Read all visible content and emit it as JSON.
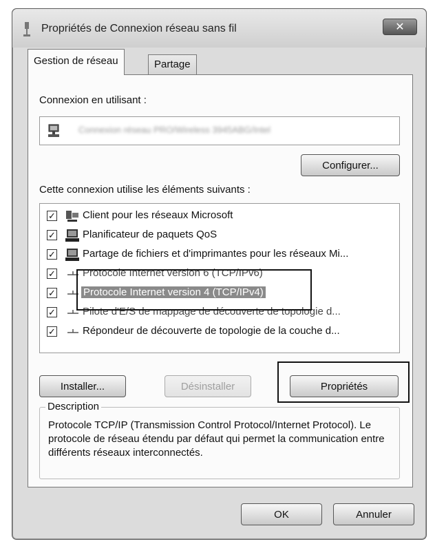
{
  "window": {
    "title": "Propriétés de Connexion réseau sans fil",
    "close_label": "✕"
  },
  "tabs": [
    {
      "label": "Gestion de réseau",
      "active": true
    },
    {
      "label": "Partage",
      "active": false
    }
  ],
  "connection": {
    "label": "Connexion en utilisant :",
    "adapter_name": "Connexion réseau PRO/Wireless 3945ABG/Intel",
    "configure_label": "Configurer..."
  },
  "items_section": {
    "label": "Cette connexion utilise les éléments suivants :",
    "items": [
      {
        "checked": true,
        "icon": "network-client-icon",
        "label": "Client pour les réseaux Microsoft"
      },
      {
        "checked": true,
        "icon": "network-service-icon",
        "label": "Planificateur de paquets QoS"
      },
      {
        "checked": true,
        "icon": "network-service-icon",
        "label": "Partage de fichiers et d'imprimantes pour les réseaux Mi..."
      },
      {
        "checked": true,
        "icon": "protocol-icon",
        "label": "Protocole Internet version 6 (TCP/IPv6)"
      },
      {
        "checked": true,
        "icon": "protocol-icon",
        "label": "Protocole Internet version 4 (TCP/IPv4)",
        "selected": true
      },
      {
        "checked": true,
        "icon": "protocol-icon",
        "label": "Pilote d'E/S de mappage de découverte de topologie d..."
      },
      {
        "checked": true,
        "icon": "protocol-icon",
        "label": "Répondeur de découverte de topologie de la couche d..."
      }
    ]
  },
  "actions": {
    "install_label": "Installer...",
    "uninstall_label": "Désinstaller",
    "properties_label": "Propriétés"
  },
  "description": {
    "legend": "Description",
    "text": "Protocole TCP/IP (Transmission Control Protocol/Internet Protocol). Le protocole de réseau étendu par défaut qui permet la communication entre différents réseaux interconnectés."
  },
  "footer": {
    "ok_label": "OK",
    "cancel_label": "Annuler"
  },
  "colors": {
    "selection": "#8a8a8a",
    "dialog_bg": "#dcdcdc",
    "panel_bg": "#fbfbfb"
  }
}
